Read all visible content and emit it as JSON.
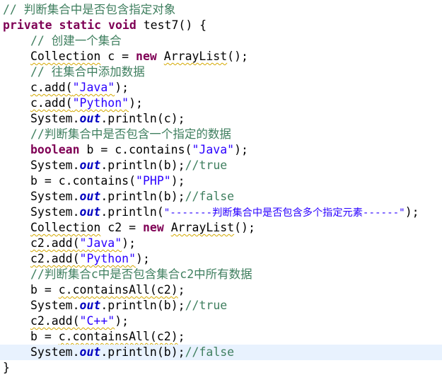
{
  "editor": {
    "current_line_color": "#e8f2fe",
    "syntax_colors": {
      "keyword": "#7f0055",
      "comment": "#3f7f5f",
      "string": "#2a00ff",
      "static_field": "#0000c0"
    },
    "lines": {
      "l0": {
        "t0": "// 判断集合中是否包含指定对象"
      },
      "l1": {
        "t0": "private",
        "t1": " ",
        "t2": "static",
        "t3": " ",
        "t4": "void",
        "t5": " test7() {"
      },
      "l2": {
        "t0": "// 创建一个集合"
      },
      "l3": {
        "t0": "Collection",
        "t1": " c = ",
        "t2": "new",
        "t3": " ",
        "t4": "ArrayList",
        "t5": "();"
      },
      "l4": {
        "t0": "// 往集合中添加数据"
      },
      "l5": {
        "t0": "c.add(",
        "t1": "\"Java\"",
        "t2": ");"
      },
      "l6": {
        "t0": "c.add(",
        "t1": "\"Python\"",
        "t2": ");"
      },
      "l7": {
        "t0": "System.",
        "t1": "out",
        "t2": ".println(c);"
      },
      "l8": {
        "t0": "//判断集合中是否包含一个指定的数据"
      },
      "l9": {
        "t0": "boolean",
        "t1": " b = c.contains(",
        "t2": "\"Java\"",
        "t3": ");"
      },
      "l10": {
        "t0": "System.",
        "t1": "out",
        "t2": ".println(b);",
        "t3": "//true"
      },
      "l11": {
        "t0": "b = c.contains(",
        "t1": "\"PHP\"",
        "t2": ");"
      },
      "l12": {
        "t0": "System.",
        "t1": "out",
        "t2": ".println(b);",
        "t3": "//false"
      },
      "l13": {
        "t0": "System.",
        "t1": "out",
        "t2": ".println(",
        "t3": "\"-------判断集合中是否包含多个指定元素------\"",
        "t4": ");"
      },
      "l14": {
        "t0": "Collection",
        "t1": " c2 = ",
        "t2": "new",
        "t3": " ",
        "t4": "ArrayList",
        "t5": "();"
      },
      "l15": {
        "t0": "c2.add(",
        "t1": "\"Java\"",
        "t2": ");"
      },
      "l16": {
        "t0": "c2.add(",
        "t1": "\"Python\"",
        "t2": ");"
      },
      "l17": {
        "t0": "//判断集合c中是否包含集合c2中所有数据"
      },
      "l18": {
        "t0": "b = ",
        "t1": "c.containsAll(c2)",
        "t2": ";"
      },
      "l19": {
        "t0": "System.",
        "t1": "out",
        "t2": ".println(b);",
        "t3": "//true"
      },
      "l20": {
        "t0": "c2.add(",
        "t1": "\"C++\"",
        "t2": ");"
      },
      "l21": {
        "t0": "b = ",
        "t1": "c.containsAll(c2)",
        "t2": ";"
      },
      "l22": {
        "t0": "System.",
        "t1": "out",
        "t2": ".println(b);",
        "t3": "//false"
      },
      "l23": {
        "t0": "}"
      }
    }
  }
}
